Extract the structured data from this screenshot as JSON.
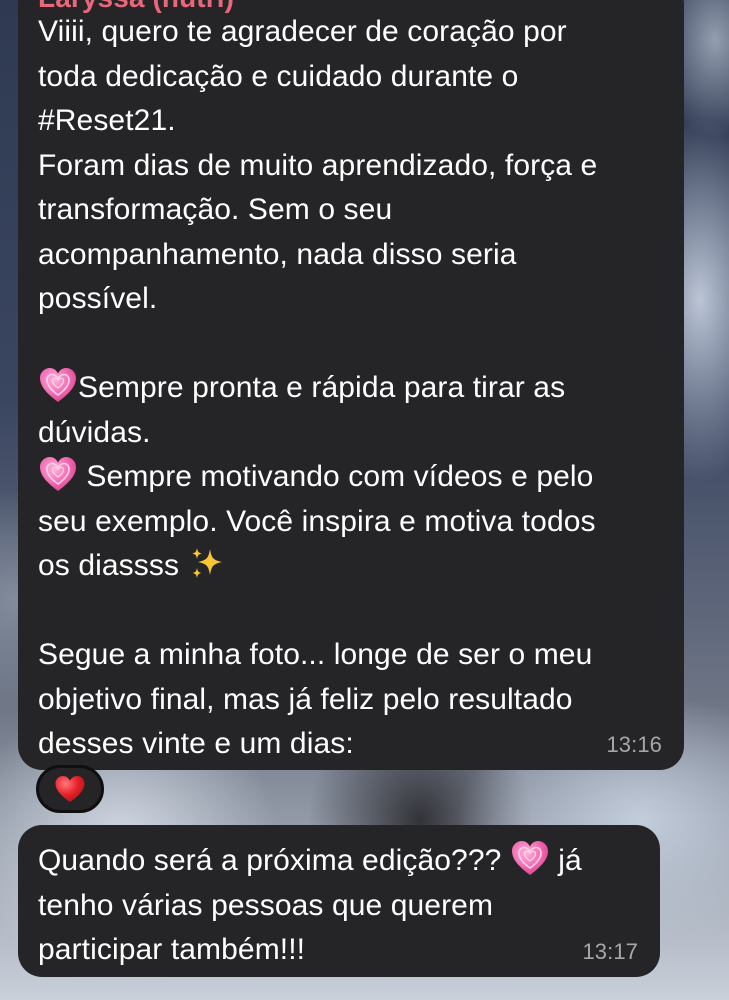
{
  "chat": {
    "messages": [
      {
        "sender": "Laryssa (nutri)",
        "sender_color": "#e8677a",
        "segments": [
          "Viiii, quero te agradecer de coração por\ntoda dedicação e cuidado durante o\n#Reset21.\nForam dias de muito aprendizado, força e\ntransformação. Sem o seu\nacompanhamento, nada disso seria\npossível.\n\n",
          "Sempre pronta e rápida para tirar as\ndúvidas.\n",
          " Sempre motivando com vídeos e pelo\nseu exemplo. Você inspira e motiva todos\nos diassss ",
          "\n\nSegue a minha foto... longe de ser o meu\nobjetivo final, mas já feliz pelo resultado\ndesses vinte e um dias:"
        ],
        "emojis": [
          "growing-heart",
          "growing-heart",
          "sparkles"
        ],
        "time": "13:16",
        "reaction": "red-heart"
      },
      {
        "segments": [
          "Quando será a próxima edição??? ",
          " já\ntenho várias pessoas que querem\nparticipar também!!!"
        ],
        "emojis": [
          "growing-heart"
        ],
        "time": "13:17"
      }
    ]
  },
  "colors": {
    "bubble": "#252527",
    "text": "#ffffff",
    "timestamp": "#a7a7ab",
    "heart_pink": "#f06ab0",
    "heart_red": "#e8222b"
  }
}
